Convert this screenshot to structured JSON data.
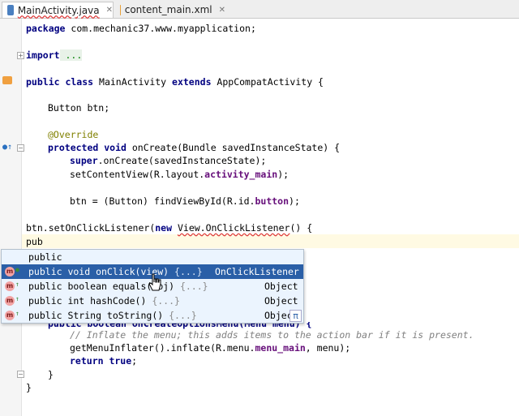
{
  "tabs": [
    {
      "label": "MainActivity.java",
      "active": true,
      "icon": "java-class-icon",
      "color": "#4a7fc0"
    },
    {
      "label": "content_main.xml",
      "active": false,
      "icon": "xml-file-icon",
      "color": "#e8a13a"
    }
  ],
  "code": {
    "package": {
      "kw": "package",
      "rest": " com.mechanic37.www.myapplication;"
    },
    "import": {
      "kw": "import",
      "rest": " ..."
    },
    "class": {
      "kw1": "public class",
      "name": " MainActivity ",
      "kw2": "extends",
      "rest": " AppCompatActivity {"
    },
    "field": "Button btn;",
    "override": "@Override",
    "oncreate": {
      "kw": "protected void",
      "rest": " onCreate(Bundle savedInstanceState) {"
    },
    "super": {
      "kw": "super",
      "rest": ".onCreate(savedInstanceState);"
    },
    "setcontent": {
      "pre": "setContentView(R.layout.",
      "fld": "activity_main",
      "post": ");"
    },
    "findview": {
      "pre": "btn = (Button) findViewById(R.id.",
      "fld": "button",
      "post": ");"
    },
    "listener": {
      "pre": "btn.setOnClickListener(",
      "kw": "new",
      "mid": " ",
      "ul": "View.OnClickListener",
      "post": "() {"
    },
    "typed": "pub",
    "hidden": "public boolean onCreateOptionsMenu(Menu menu) {",
    "comment": "// Inflate the menu; this adds items to the action bar if it is present.",
    "inflate": {
      "pre": "getMenuInflater().inflate(R.menu.",
      "fld": "menu_main",
      "post": ", menu);"
    },
    "return": {
      "kw": "return true",
      "post": ";"
    },
    "close_inner": "}",
    "close_outer": "}"
  },
  "autocomplete": {
    "items": [
      {
        "text": "public",
        "grey": "",
        "ret": "",
        "icon": false
      },
      {
        "text": "public void onClick(view)",
        "grey": " {...}",
        "ret": "OnClickListener",
        "icon": true,
        "selected": true
      },
      {
        "text": "public boolean equals(obj)",
        "grey": " {...}",
        "ret": "Object",
        "icon": true
      },
      {
        "text": "public int hashCode()",
        "grey": " {...}",
        "ret": "Object",
        "icon": true
      },
      {
        "text": "public String toString()",
        "grey": " {...}",
        "ret": "Object",
        "icon": true
      }
    ],
    "pi_symbol": "π",
    "method_icon_letter": "m",
    "accent": "#2a5fa7"
  }
}
